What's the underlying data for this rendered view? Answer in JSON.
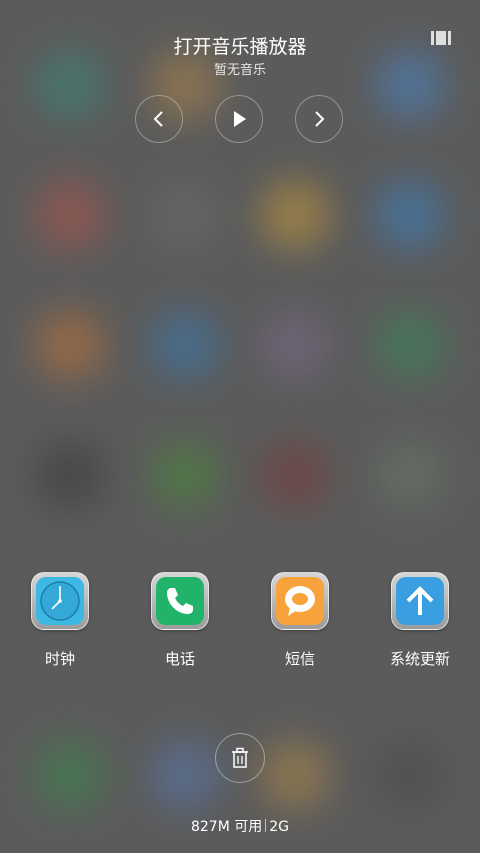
{
  "music_widget": {
    "title": "打开音乐播放器",
    "subtitle": "暂无音乐",
    "prev_icon": "chevron-left-icon",
    "play_icon": "play-icon",
    "next_icon": "chevron-right-icon",
    "toggle_icon": "widget-toggle-icon"
  },
  "recent_apps": [
    {
      "label": "时钟",
      "icon": "clock-icon",
      "color": "#3db8e3"
    },
    {
      "label": "电话",
      "icon": "phone-icon",
      "color": "#22b36a"
    },
    {
      "label": "短信",
      "icon": "message-icon",
      "color": "#f7a23a"
    },
    {
      "label": "系统更新",
      "icon": "arrow-up-icon",
      "color": "#3a9fe0"
    }
  ],
  "clear_button": {
    "icon": "trash-icon"
  },
  "memory": {
    "free": "827M 可用",
    "total": "2G"
  },
  "colors": {
    "background": "#5b5b5b"
  }
}
